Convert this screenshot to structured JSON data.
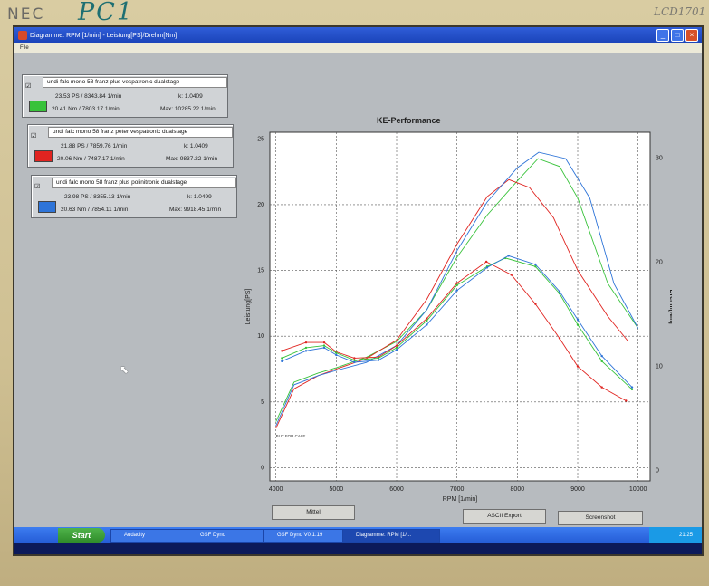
{
  "monitor": {
    "brand": "NEC",
    "label": "PC1",
    "model": "LCD1701"
  },
  "window": {
    "title": "Diagramme: RPM [1/min] - Leistung[PS]/Drehm[Nm]",
    "menu_file": "File"
  },
  "legend": [
    {
      "name": "undi falc mono 58 franz plus vespatronic dualstage",
      "checked": "☑",
      "line1": "23.53 PS / 8343.84 1/min",
      "k": "k: 1.0409",
      "line2": "20.41 Nm / 7803.17 1/min",
      "max": "Max: 10285.22 1/min",
      "color": "#38c23a"
    },
    {
      "name": "undi falc mono 58 franz peter vespatronic dualstage",
      "checked": "☑",
      "line1": "21.88 PS / 7859.76 1/min",
      "k": "k: 1.0409",
      "line2": "20.06 Nm / 7487.17 1/min",
      "max": "Max: 9837.22 1/min",
      "color": "#e02420"
    },
    {
      "name": "undi falc mono 58 franz plus polinitronic dualstage",
      "checked": "☑",
      "line1": "23.98 PS / 8355.13 1/min",
      "k": "k: 1.0499",
      "line2": "20.63 Nm / 7854.11 1/min",
      "max": "Max: 9918.45 1/min",
      "color": "#2e74d8"
    }
  ],
  "buttons": {
    "mittel": "Mittel",
    "ascii": "ASCII Export",
    "screenshot": "Screenshot"
  },
  "taskbar": {
    "start": "Start",
    "tasks": [
      "Audacity",
      "GSF Dyno",
      "GSF Dyno V0.1.19",
      "Diagramme: RPM [1/..."
    ],
    "clock": "21:25"
  },
  "chart_data": {
    "type": "line",
    "title": "KE-Performance",
    "xlabel": "RPM [1/min]",
    "ylabel": "Leistung[PS]",
    "y2label": "Drehm[Nm]",
    "xlim": [
      3900,
      10200
    ],
    "ylim": [
      -1,
      25.5
    ],
    "y2lim": [
      -1,
      32.5
    ],
    "xticks": [
      "4000",
      "5000",
      "6000",
      "7000",
      "8000",
      "9000",
      "10000"
    ],
    "yticks": [
      "0",
      "5",
      "10",
      "15",
      "20",
      "25"
    ],
    "y2ticks": [
      "0",
      "10",
      "20",
      "30"
    ],
    "grid": true,
    "annotation": "BUT FOR CALE",
    "series": [
      {
        "color": "#38c23a",
        "axis": "power",
        "x": [
          4000,
          4300,
          4700,
          5000,
          5500,
          6000,
          6500,
          7000,
          7500,
          8000,
          8343,
          8700,
          9000,
          9500,
          10000
        ],
        "y": [
          3.5,
          6.5,
          7.2,
          7.6,
          8.4,
          9.6,
          12.0,
          16.0,
          19.2,
          21.8,
          23.5,
          22.9,
          20.5,
          14.0,
          10.6
        ]
      },
      {
        "color": "#e02420",
        "axis": "power",
        "x": [
          4000,
          4300,
          4700,
          5000,
          5500,
          6000,
          6500,
          7000,
          7500,
          7860,
          8200,
          8600,
          9000,
          9500,
          9837
        ],
        "y": [
          3.0,
          6.0,
          7.0,
          7.5,
          8.3,
          9.7,
          12.8,
          17.0,
          20.6,
          21.9,
          21.3,
          19.0,
          15.0,
          11.5,
          9.6
        ]
      },
      {
        "color": "#2e74d8",
        "axis": "power",
        "x": [
          4000,
          4300,
          4700,
          5000,
          5500,
          6000,
          6500,
          7000,
          7500,
          8000,
          8355,
          8800,
          9200,
          9600,
          10000
        ],
        "y": [
          3.2,
          6.3,
          7.0,
          7.4,
          8.0,
          9.3,
          12.0,
          16.5,
          20.2,
          22.8,
          23.98,
          23.5,
          20.5,
          14.0,
          10.6
        ]
      },
      {
        "color": "#e02420",
        "axis": "torque",
        "markers": true,
        "x": [
          4100,
          4500,
          4800,
          5000,
          5300,
          5700,
          6000,
          6500,
          7000,
          7487,
          7900,
          8300,
          8700,
          9000,
          9400,
          9800
        ],
        "y": [
          11.5,
          12.3,
          12.3,
          11.4,
          10.8,
          10.9,
          12.0,
          14.6,
          18.0,
          20.06,
          18.8,
          16.0,
          12.7,
          10.0,
          8.0,
          6.7
        ]
      },
      {
        "color": "#38c23a",
        "axis": "torque",
        "markers": true,
        "x": [
          4100,
          4500,
          4800,
          5000,
          5300,
          5700,
          6000,
          6500,
          7000,
          7500,
          7803,
          8300,
          8700,
          9000,
          9400,
          9900
        ],
        "y": [
          10.8,
          11.8,
          12.0,
          11.3,
          10.6,
          10.8,
          11.8,
          14.4,
          17.8,
          19.6,
          20.41,
          19.6,
          17.0,
          14.0,
          10.5,
          7.8
        ]
      },
      {
        "color": "#2e74d8",
        "axis": "torque",
        "markers": true,
        "x": [
          4100,
          4500,
          4800,
          5000,
          5300,
          5700,
          6000,
          6500,
          7000,
          7500,
          7854,
          8300,
          8700,
          9000,
          9400,
          9900
        ],
        "y": [
          10.5,
          11.5,
          11.8,
          11.1,
          10.4,
          10.6,
          11.6,
          14.0,
          17.3,
          19.5,
          20.63,
          19.8,
          17.2,
          14.5,
          11.0,
          8.0
        ]
      }
    ]
  }
}
